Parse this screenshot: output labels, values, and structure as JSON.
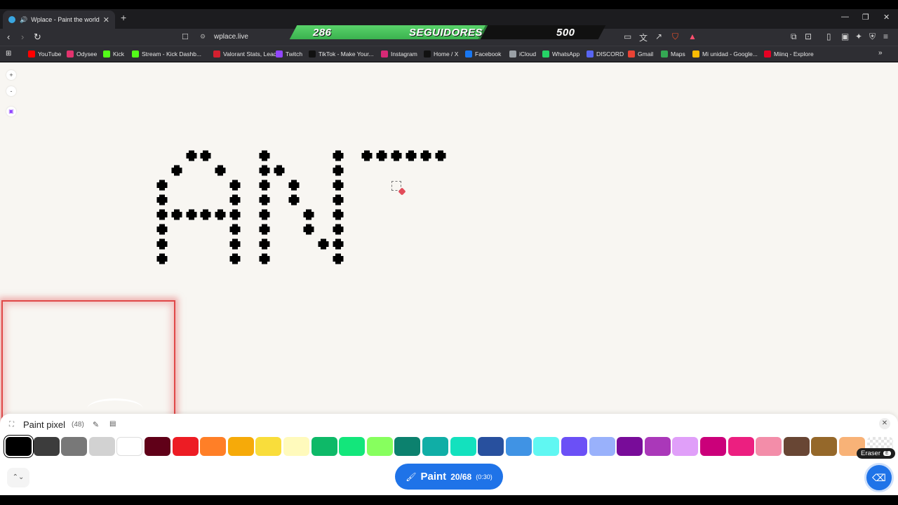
{
  "browser": {
    "tab_title": "Wplace - Paint the world",
    "url": "wplace.live",
    "new_tab": "+",
    "window": {
      "minimize": "—",
      "restore": "❐",
      "close": "✕"
    },
    "nav": {
      "back": "‹",
      "forward": "›",
      "reload": "↻"
    }
  },
  "overlay": {
    "current": "286",
    "label": "SEGUIDORES",
    "goal": "500",
    "progress_fraction": 0.572
  },
  "bookmarks": [
    {
      "label": "YouTube",
      "color": "#ff0000"
    },
    {
      "label": "Odysee",
      "color": "#e2336e"
    },
    {
      "label": "Kick",
      "color": "#53fc18"
    },
    {
      "label": "Stream - Kick Dashb...",
      "color": "#53fc18"
    },
    {
      "label": "Valorant Stats, Lead...",
      "color": "#d4202f"
    },
    {
      "label": "Twitch",
      "color": "#9146ff"
    },
    {
      "label": "TikTok - Make Your...",
      "color": "#111111"
    },
    {
      "label": "Instagram",
      "color": "#d62976"
    },
    {
      "label": "Home / X",
      "color": "#111111"
    },
    {
      "label": "Facebook",
      "color": "#1877f2"
    },
    {
      "label": "iCloud",
      "color": "#9aa0a6"
    },
    {
      "label": "WhatsApp",
      "color": "#25d366"
    },
    {
      "label": "DISCORD",
      "color": "#5865f2"
    },
    {
      "label": "Gmail",
      "color": "#ea4335"
    },
    {
      "label": "Maps",
      "color": "#34a853"
    },
    {
      "label": "Mi unidad - Google...",
      "color": "#fbbc04"
    },
    {
      "label": "Miinq - Explore",
      "color": "#e60023"
    }
  ],
  "canvas": {
    "zoom_in": "+",
    "zoom_out": "-",
    "twitch_icon": "twitch-icon"
  },
  "palette": {
    "title": "Paint pixel",
    "count": "(48)",
    "close": "✕",
    "colors": [
      "#000000",
      "#3c3c3c",
      "#787878",
      "#d2d2d2",
      "#ffffff",
      "#600018",
      "#ed1c24",
      "#ff7f27",
      "#f6aa09",
      "#f9dd3b",
      "#fffabc",
      "#0eb968",
      "#13e67b",
      "#87ff5e",
      "#0c816e",
      "#10aea6",
      "#13e1be",
      "#28509e",
      "#4093e4",
      "#60f7f2",
      "#6b50f6",
      "#99b1fb",
      "#780c99",
      "#aa38b9",
      "#e09ff9",
      "#cb007a",
      "#ec1f80",
      "#f38da9",
      "#684634",
      "#95682a",
      "#f8b277",
      "transparent"
    ],
    "eraser_tooltip": "Eraser",
    "eraser_key": "E",
    "collapse": "⌃⌄"
  },
  "paint_button": {
    "label": "Paint",
    "charges": "20/68",
    "timer": "(0:30)"
  }
}
